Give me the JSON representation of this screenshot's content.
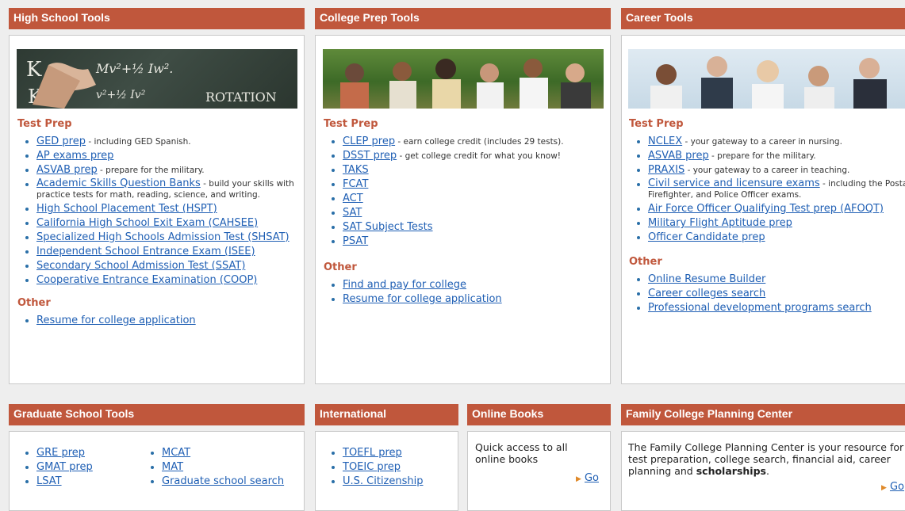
{
  "high_school": {
    "title": "High School Tools",
    "board_text": "K ... Mv²+½ Iw²  ROTATION",
    "test_prep_label": "Test Prep",
    "test_prep": [
      {
        "link": "GED prep",
        "desc": " - including GED Spanish."
      },
      {
        "link": "AP exams prep",
        "desc": ""
      },
      {
        "link": "ASVAB prep",
        "desc": " - prepare for the military."
      },
      {
        "link": "Academic Skills Question Banks",
        "desc": " - build your skills with practice tests for math, reading, science, and writing."
      },
      {
        "link": "High School Placement Test (HSPT)",
        "desc": ""
      },
      {
        "link": "California High School Exit Exam (CAHSEE)",
        "desc": ""
      },
      {
        "link": "Specialized High Schools Admission Test (SHSAT)",
        "desc": ""
      },
      {
        "link": "Independent School Entrance Exam (ISEE)",
        "desc": ""
      },
      {
        "link": "Secondary School Admission Test (SSAT)",
        "desc": ""
      },
      {
        "link": "Cooperative Entrance Examination (COOP)",
        "desc": ""
      }
    ],
    "other_label": "Other",
    "other": [
      {
        "link": "Resume for college application",
        "desc": ""
      }
    ]
  },
  "college_prep": {
    "title": "College Prep Tools",
    "test_prep_label": "Test Prep",
    "test_prep": [
      {
        "link": "CLEP prep",
        "desc": " - earn college credit (includes 29 tests)."
      },
      {
        "link": "DSST prep",
        "desc": " - get college credit for what you know!"
      },
      {
        "link": "TAKS",
        "desc": ""
      },
      {
        "link": "FCAT",
        "desc": ""
      },
      {
        "link": "ACT",
        "desc": ""
      },
      {
        "link": "SAT",
        "desc": ""
      },
      {
        "link": "SAT Subject Tests",
        "desc": ""
      },
      {
        "link": "PSAT",
        "desc": ""
      }
    ],
    "other_label": "Other",
    "other": [
      {
        "link": "Find and pay for college",
        "desc": ""
      },
      {
        "link": "Resume for college application",
        "desc": ""
      }
    ]
  },
  "career": {
    "title": "Career Tools",
    "test_prep_label": "Test Prep",
    "test_prep": [
      {
        "link": "NCLEX",
        "desc": " - your gateway to a career in nursing."
      },
      {
        "link": "ASVAB prep",
        "desc": " - prepare for the military."
      },
      {
        "link": "PRAXIS",
        "desc": " - your gateway to a career in teaching."
      },
      {
        "link": "Civil service and licensure exams",
        "desc": " - including the Postal, Firefighter, and Police Officer exams."
      },
      {
        "link": "Air Force Officer Qualifying Test prep (AFOQT)",
        "desc": ""
      },
      {
        "link": "Military Flight Aptitude prep",
        "desc": ""
      },
      {
        "link": "Officer Candidate prep",
        "desc": ""
      }
    ],
    "other_label": "Other",
    "other": [
      {
        "link": "Online Resume Builder",
        "desc": ""
      },
      {
        "link": "Career colleges search",
        "desc": ""
      },
      {
        "link": "Professional development programs search",
        "desc": ""
      }
    ]
  },
  "graduate": {
    "title": "Graduate School Tools",
    "col1": [
      "GRE prep",
      "GMAT prep",
      "LSAT"
    ],
    "col2": [
      "MCAT",
      "MAT",
      "Graduate school search"
    ]
  },
  "international": {
    "title": "International",
    "items": [
      "TOEFL prep",
      "TOEIC prep",
      "U.S. Citizenship"
    ]
  },
  "online_books": {
    "title": "Online Books",
    "text": "Quick access to all online books",
    "go": "Go"
  },
  "family": {
    "title": "Family College Planning Center",
    "text": "The Family College Planning Center is your resource for test preparation, college search, financial aid, career planning and ",
    "bold": "scholarships",
    "tail": ".",
    "go": "Go"
  },
  "colors": {
    "header": "#c0573c",
    "link": "#1f5fb4",
    "section": "#c0573c"
  }
}
